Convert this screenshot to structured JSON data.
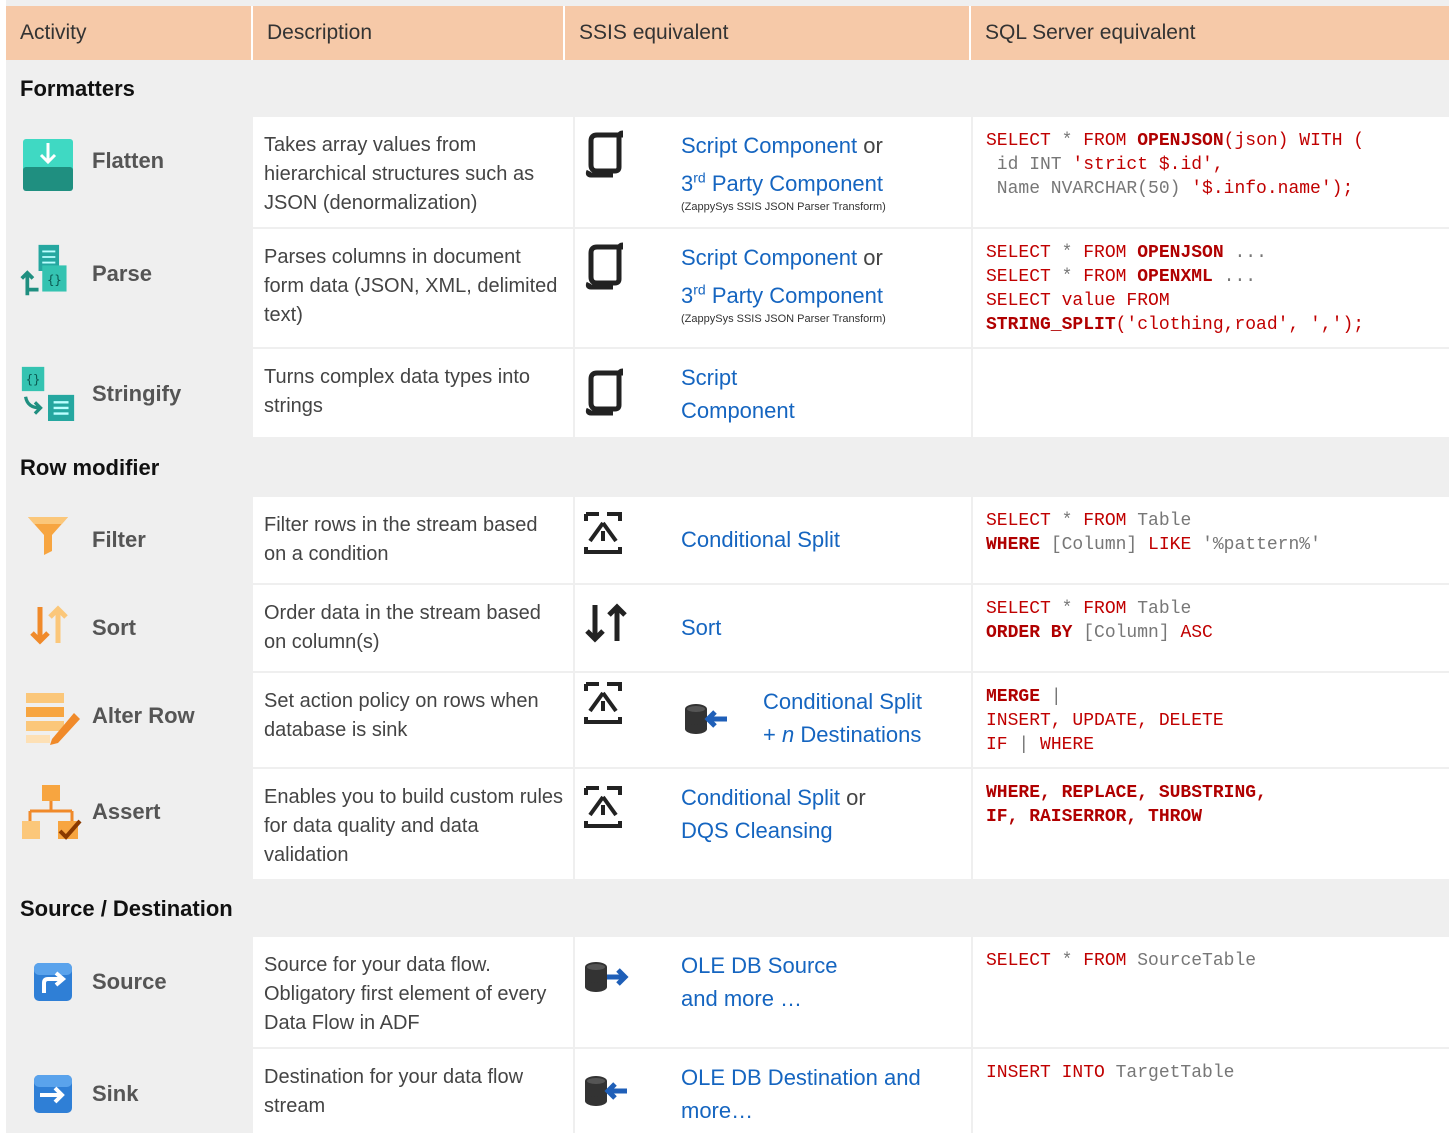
{
  "header": {
    "activity": "Activity",
    "description": "Description",
    "ssis": "SSIS equivalent",
    "sql": "SQL Server equivalent"
  },
  "sections": {
    "formatters": "Formatters",
    "row_modifier": "Row modifier",
    "source_destination": "Source / Destination"
  },
  "colors": {
    "header_bg": "#f6c9a8",
    "link_blue": "#1565c0",
    "sql_red": "#c00000",
    "section_bg": "#efefef"
  },
  "rows": {
    "flatten": {
      "icon": "flatten-icon",
      "name": "Flatten",
      "desc": "Takes array values from hierarchical structures such as JSON (denormalization)",
      "ssis_icon": "script-component-icon",
      "ssis_link1": "Script Component",
      "ssis_or": " or",
      "ssis_link2_pre": "3",
      "ssis_sup": "rd",
      "ssis_link2": " Party Component",
      "ssis_note": "(ZappySys SSIS JSON Parser Transform)"
    },
    "parse": {
      "icon": "parse-icon",
      "name": "Parse",
      "desc": "Parses columns in document form data (JSON, XML, delimited text)",
      "ssis_icon": "script-component-icon",
      "ssis_link1": "Script Component",
      "ssis_or": " or",
      "ssis_link2_pre": "3",
      "ssis_sup": "rd",
      "ssis_link2": " Party Component",
      "ssis_note": "(ZappySys SSIS JSON Parser Transform)"
    },
    "stringify": {
      "icon": "stringify-icon",
      "name": "Stringify",
      "desc": "Turns complex data types into strings",
      "ssis_icon": "script-component-icon",
      "ssis_line1": "Script",
      "ssis_line2": "Component"
    },
    "filter": {
      "icon": "funnel-icon",
      "name": "Filter",
      "desc": "Filter rows in the stream based on a condition",
      "ssis_icon": "conditional-split-icon",
      "ssis_link1": "Conditional Split"
    },
    "sort": {
      "icon": "sort-arrows-icon",
      "name": "Sort",
      "desc": "Order data in the stream based on column(s)",
      "ssis_icon": "sort-icon",
      "ssis_link1": "Sort"
    },
    "alter_row": {
      "icon": "alter-row-icon",
      "name": "Alter Row",
      "desc": "Set action policy on rows when database is sink",
      "ssis_icon": "conditional-split-icon",
      "ssis_icon2": "destination-icon",
      "ssis_line1": "Conditional Split",
      "ssis_plus": "+ ",
      "ssis_n": "n",
      "ssis_line2": " Destinations"
    },
    "assert": {
      "icon": "assert-icon",
      "name": "Assert",
      "desc": "Enables you to build custom rules for data quality and data validation",
      "ssis_icon": "conditional-split-icon",
      "ssis_link1": "Conditional Split",
      "ssis_or": " or",
      "ssis_link2": "DQS Cleansing"
    },
    "source": {
      "icon": "source-icon",
      "name": "Source",
      "desc": "Source for your data flow. Obligatory first element of every Data Flow in ADF",
      "ssis_icon": "ole-db-source-icon",
      "ssis_line1": "OLE DB Source",
      "ssis_line2": "and more …"
    },
    "sink": {
      "icon": "sink-icon",
      "name": "Sink",
      "desc": "Destination for your data flow stream",
      "ssis_icon": "ole-db-destination-icon",
      "ssis_line1": "OLE DB Destination and",
      "ssis_line2": "more…"
    }
  },
  "sql": {
    "flatten": {
      "l1a": "SELECT ",
      "l1b": "* ",
      "l1c": "FROM ",
      "l1d": "OPENJSON",
      "l1e": "(json) WITH (",
      "l2a": " id INT ",
      "l2b": "'strict $.id',",
      "l3a": " Name NVARCHAR(50) ",
      "l3b": "'$.info.name');"
    },
    "parse": {
      "l1a": "SELECT ",
      "l1b": "* ",
      "l1c": "FROM ",
      "l1d": "OPENJSON",
      "l1e": " ...",
      "l2a": "SELECT ",
      "l2b": "* ",
      "l2c": "FROM ",
      "l2d": "OPENXML",
      "l2e": " ...",
      "l3": "SELECT value FROM",
      "l4a": "STRING_SPLIT",
      "l4b": "('clothing,road', ',');"
    },
    "filter": {
      "l1a": "SELECT ",
      "l1b": "* ",
      "l1c": "FROM ",
      "l1d": "Table",
      "l2a": "WHERE",
      "l2b": " [Column] ",
      "l2c": "LIKE ",
      "l2d": "'%pattern%'"
    },
    "sort": {
      "l1a": "SELECT ",
      "l1b": "* ",
      "l1c": "FROM ",
      "l1d": "Table",
      "l2a": "ORDER BY",
      "l2b": " [Column] ",
      "l2c": "ASC"
    },
    "alter_row": {
      "l1a": "MERGE",
      "l1b": " |",
      "l2": "INSERT, UPDATE, DELETE",
      "l3a": "IF ",
      "l3b": "| ",
      "l3c": "WHERE"
    },
    "assert": {
      "l1": "WHERE, REPLACE, SUBSTRING,",
      "l2": "IF, RAISERROR, THROW"
    },
    "source": {
      "l1a": "SELECT ",
      "l1b": "* ",
      "l1c": "FROM ",
      "l1d": "SourceTable"
    },
    "sink": {
      "l1a": "INSERT INTO ",
      "l1b": "TargetTable"
    }
  }
}
